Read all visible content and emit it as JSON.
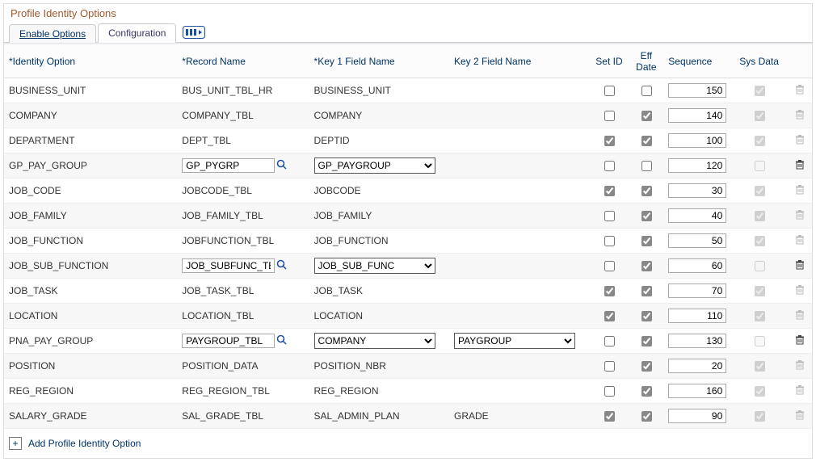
{
  "pageTitle": "Profile Identity Options",
  "tabs": {
    "enable": "Enable Options",
    "config": "Configuration"
  },
  "columns": {
    "identity": "*Identity Option",
    "record": "*Record Name",
    "key1": "*Key 1 Field Name",
    "key2": "Key 2 Field Name",
    "setid": "Set ID",
    "effdate": "Eff Date",
    "sequence": "Sequence",
    "sysdata": "Sys Data"
  },
  "addLink": "Add Profile Identity Option",
  "rows": [
    {
      "id": "BUSINESS_UNIT",
      "rec": "BUS_UNIT_TBL_HR",
      "recEdit": false,
      "k1": "BUSINESS_UNIT",
      "k1Sel": false,
      "k2": "",
      "k2Sel": false,
      "set": false,
      "eff": false,
      "seq": "150",
      "sys": true,
      "sysDis": true,
      "trash": "light"
    },
    {
      "id": "COMPANY",
      "rec": "COMPANY_TBL",
      "recEdit": false,
      "k1": "COMPANY",
      "k1Sel": false,
      "k2": "",
      "k2Sel": false,
      "set": false,
      "eff": true,
      "seq": "140",
      "sys": true,
      "sysDis": true,
      "trash": "light"
    },
    {
      "id": "DEPARTMENT",
      "rec": "DEPT_TBL",
      "recEdit": false,
      "k1": "DEPTID",
      "k1Sel": false,
      "k2": "",
      "k2Sel": false,
      "set": true,
      "eff": true,
      "seq": "100",
      "sys": true,
      "sysDis": true,
      "trash": "light"
    },
    {
      "id": "GP_PAY_GROUP",
      "rec": "GP_PYGRP",
      "recEdit": true,
      "k1": "GP_PAYGROUP",
      "k1Sel": true,
      "k2": "",
      "k2Sel": false,
      "set": false,
      "eff": false,
      "seq": "120",
      "sys": false,
      "sysDis": true,
      "trash": "dark"
    },
    {
      "id": "JOB_CODE",
      "rec": "JOBCODE_TBL",
      "recEdit": false,
      "k1": "JOBCODE",
      "k1Sel": false,
      "k2": "",
      "k2Sel": false,
      "set": true,
      "eff": true,
      "seq": "30",
      "sys": true,
      "sysDis": true,
      "trash": "light"
    },
    {
      "id": "JOB_FAMILY",
      "rec": "JOB_FAMILY_TBL",
      "recEdit": false,
      "k1": "JOB_FAMILY",
      "k1Sel": false,
      "k2": "",
      "k2Sel": false,
      "set": false,
      "eff": true,
      "seq": "40",
      "sys": true,
      "sysDis": true,
      "trash": "light"
    },
    {
      "id": "JOB_FUNCTION",
      "rec": "JOBFUNCTION_TBL",
      "recEdit": false,
      "k1": "JOB_FUNCTION",
      "k1Sel": false,
      "k2": "",
      "k2Sel": false,
      "set": false,
      "eff": true,
      "seq": "50",
      "sys": true,
      "sysDis": true,
      "trash": "light"
    },
    {
      "id": "JOB_SUB_FUNCTION",
      "rec": "JOB_SUBFUNC_TBL",
      "recEdit": true,
      "k1": "JOB_SUB_FUNC",
      "k1Sel": true,
      "k2": "",
      "k2Sel": false,
      "set": false,
      "eff": true,
      "seq": "60",
      "sys": false,
      "sysDis": true,
      "trash": "dark"
    },
    {
      "id": "JOB_TASK",
      "rec": "JOB_TASK_TBL",
      "recEdit": false,
      "k1": "JOB_TASK",
      "k1Sel": false,
      "k2": "",
      "k2Sel": false,
      "set": true,
      "eff": true,
      "seq": "70",
      "sys": true,
      "sysDis": true,
      "trash": "light"
    },
    {
      "id": "LOCATION",
      "rec": "LOCATION_TBL",
      "recEdit": false,
      "k1": "LOCATION",
      "k1Sel": false,
      "k2": "",
      "k2Sel": false,
      "set": true,
      "eff": true,
      "seq": "110",
      "sys": true,
      "sysDis": true,
      "trash": "light"
    },
    {
      "id": "PNA_PAY_GROUP",
      "rec": "PAYGROUP_TBL",
      "recEdit": true,
      "k1": "COMPANY",
      "k1Sel": true,
      "k2": "PAYGROUP",
      "k2Sel": true,
      "set": false,
      "eff": true,
      "seq": "130",
      "sys": false,
      "sysDis": true,
      "trash": "dark"
    },
    {
      "id": "POSITION",
      "rec": "POSITION_DATA",
      "recEdit": false,
      "k1": "POSITION_NBR",
      "k1Sel": false,
      "k2": "",
      "k2Sel": false,
      "set": false,
      "eff": true,
      "seq": "20",
      "sys": true,
      "sysDis": true,
      "trash": "light"
    },
    {
      "id": "REG_REGION",
      "rec": "REG_REGION_TBL",
      "recEdit": false,
      "k1": "REG_REGION",
      "k1Sel": false,
      "k2": "",
      "k2Sel": false,
      "set": false,
      "eff": true,
      "seq": "160",
      "sys": true,
      "sysDis": true,
      "trash": "light"
    },
    {
      "id": "SALARY_GRADE",
      "rec": "SAL_GRADE_TBL",
      "recEdit": false,
      "k1": "SAL_ADMIN_PLAN",
      "k1Sel": false,
      "k2": "GRADE",
      "k2Sel": false,
      "set": true,
      "eff": true,
      "seq": "90",
      "sys": true,
      "sysDis": true,
      "trash": "light"
    }
  ]
}
